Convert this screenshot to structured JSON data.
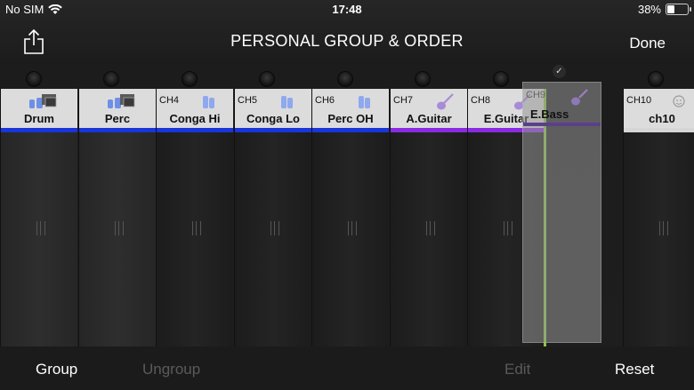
{
  "status": {
    "carrier": "No SIM",
    "time": "17:48",
    "battery": "38%",
    "battery_level": 0.38
  },
  "nav": {
    "title": "PERSONAL GROUP & ORDER",
    "done_label": "Done",
    "share_icon": "share-icon"
  },
  "colors": {
    "blue": "#1a35d8",
    "purple": "#8a2be2",
    "light": "#d6d6d6",
    "insert": "#8dc63f"
  },
  "channels": [
    {
      "ch": "",
      "name": "Drum",
      "icon": "drum-group-icon",
      "bar": "blue"
    },
    {
      "ch": "",
      "name": "Perc",
      "icon": "perc-group-icon",
      "bar": "blue"
    },
    {
      "ch": "CH4",
      "name": "Conga Hi",
      "icon": "conga-icon",
      "bar": "blue"
    },
    {
      "ch": "CH5",
      "name": "Conga Lo",
      "icon": "conga-icon",
      "bar": "blue"
    },
    {
      "ch": "CH6",
      "name": "Perc OH",
      "icon": "conga-icon",
      "bar": "blue"
    },
    {
      "ch": "CH7",
      "name": "A.Guitar",
      "icon": "guitar-icon",
      "bar": "purple"
    },
    {
      "ch": "CH8",
      "name": "E.Guitar",
      "icon": "guitar-icon",
      "bar": "purple"
    },
    {
      "ch": "CH10",
      "name": "ch10",
      "icon": "smiley-icon",
      "bar": "light"
    }
  ],
  "dragging": {
    "ch": "CH9",
    "name": "E.Bass",
    "icon": "guitar-icon"
  },
  "toolbar": {
    "group": "Group",
    "ungroup": "Ungroup",
    "edit": "Edit",
    "reset": "Reset"
  }
}
